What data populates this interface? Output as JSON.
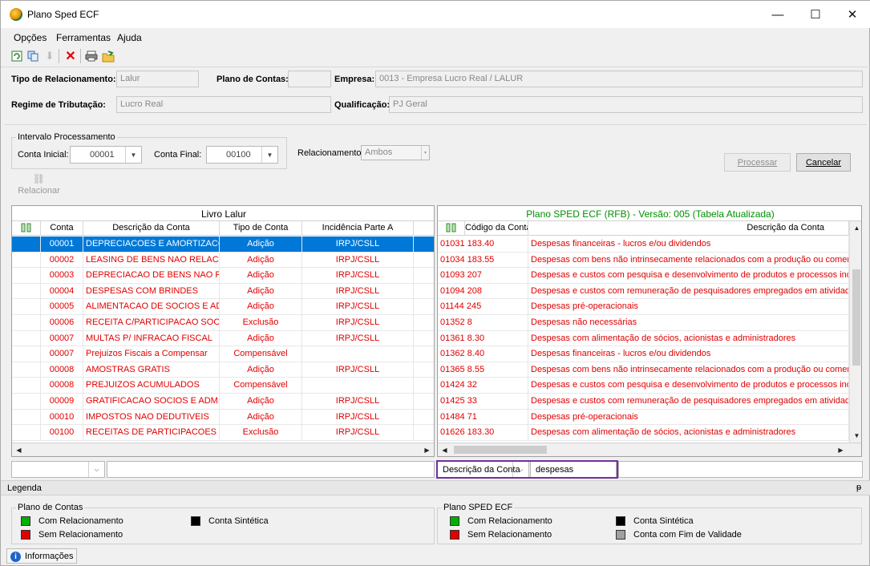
{
  "window": {
    "title": "Plano Sped ECF",
    "minimize": "—",
    "maximize": "☐",
    "close": "✕"
  },
  "menu": {
    "opcoes": "Opções",
    "ferramentas": "Ferramentas",
    "ajuda": "Ajuda"
  },
  "header": {
    "tipo_relacionamento_label": "Tipo de Relacionamento:",
    "tipo_relacionamento_value": "Lalur",
    "plano_contas_label": "Plano de Contas:",
    "plano_contas_value": "",
    "empresa_label": "Empresa:",
    "empresa_value": "0013 - Empresa Lucro Real / LALUR",
    "regime_label": "Regime de Tributação:",
    "regime_value": "Lucro Real",
    "qualificacao_label": "Qualificação:",
    "qualificacao_value": "PJ Geral"
  },
  "intervalo": {
    "title": "Intervalo Processamento",
    "conta_inicial_label": "Conta Inicial:",
    "conta_inicial_value": "00001",
    "conta_final_label": "Conta Final:",
    "conta_final_value": "00100",
    "relacionamento_label": "Relacionamento:",
    "relacionamento_value": "Ambos"
  },
  "buttons": {
    "processar": "Processar",
    "cancelar": "Cancelar",
    "relacionar": "Relacionar"
  },
  "left_grid": {
    "title": "Livro Lalur",
    "columns": [
      "Conta",
      "Descrição da Conta",
      "Tipo de Conta",
      "Incidência Parte A"
    ],
    "rows": [
      {
        "conta": "00001",
        "desc": "DEPRECIACOES E AMORTIZACOES I",
        "tipo": "Adição",
        "inc": "IRPJ/CSLL"
      },
      {
        "conta": "00002",
        "desc": "LEASING DE BENS NAO RELACIONAI",
        "tipo": "Adição",
        "inc": "IRPJ/CSLL"
      },
      {
        "conta": "00003",
        "desc": "DEPRECIACAO DE BENS NAO RELAC",
        "tipo": "Adição",
        "inc": "IRPJ/CSLL"
      },
      {
        "conta": "00004",
        "desc": "DESPESAS COM BRINDES",
        "tipo": "Adição",
        "inc": "IRPJ/CSLL"
      },
      {
        "conta": "00005",
        "desc": "ALIMENTACAO DE SOCIOS E ADMIN",
        "tipo": "Adição",
        "inc": "IRPJ/CSLL"
      },
      {
        "conta": "00006",
        "desc": "RECEITA C/PARTICIPACAO SOCIET",
        "tipo": "Exclusão",
        "inc": "IRPJ/CSLL"
      },
      {
        "conta": "00007",
        "desc": "MULTAS P/ INFRACAO FISCAL",
        "tipo": "Adição",
        "inc": "IRPJ/CSLL"
      },
      {
        "conta": "00007",
        "desc": "Prejuizos Fiscais a Compensar",
        "tipo": "Compensável",
        "inc": ""
      },
      {
        "conta": "00008",
        "desc": "AMOSTRAS GRATIS",
        "tipo": "Adição",
        "inc": "IRPJ/CSLL"
      },
      {
        "conta": "00008",
        "desc": "PREJUIZOS ACUMULADOS",
        "tipo": "Compensável",
        "inc": ""
      },
      {
        "conta": "00009",
        "desc": "GRATIFICACAO SOCIOS E ADMINIS",
        "tipo": "Adição",
        "inc": "IRPJ/CSLL"
      },
      {
        "conta": "00010",
        "desc": "IMPOSTOS NAO DEDUTIVEIS",
        "tipo": "Adição",
        "inc": "IRPJ/CSLL"
      },
      {
        "conta": "00100",
        "desc": "RECEITAS DE PARTICIPACOES SOC",
        "tipo": "Exclusão",
        "inc": "IRPJ/CSLL"
      }
    ]
  },
  "right_grid": {
    "title": "Plano SPED ECF (RFB) - Versão: 005 (Tabela Atualizada)",
    "columns": [
      "Código da Conta",
      "Descrição da Conta"
    ],
    "rows": [
      {
        "cod": "01031",
        "num": "183.40",
        "desc": "Despesas financeiras - lucros e/ou dividendos"
      },
      {
        "cod": "01034",
        "num": "183.55",
        "desc": "Despesas com bens não intrinsecamente relacionados com a produção ou comercialização"
      },
      {
        "cod": "01093",
        "num": "207",
        "desc": "Despesas e custos com pesquisa e desenvolvimento de produtos e processos inovadores"
      },
      {
        "cod": "01094",
        "num": "208",
        "desc": "Despesas e custos com remuneração de pesquisadores empregados em atividades de inc"
      },
      {
        "cod": "01144",
        "num": "245",
        "desc": "Despesas pré-operacionais"
      },
      {
        "cod": "01352",
        "num": "8",
        "desc": "Despesas não necessárias"
      },
      {
        "cod": "01361",
        "num": "8.30",
        "desc": "Despesas com alimentação de sócios, acionistas e administradores"
      },
      {
        "cod": "01362",
        "num": "8.40",
        "desc": "Despesas financeiras - lucros e/ou dividendos"
      },
      {
        "cod": "01365",
        "num": "8.55",
        "desc": "Despesas com bens não intrinsecamente relacionados com a produção ou comercialização"
      },
      {
        "cod": "01424",
        "num": "32",
        "desc": "Despesas e custos com pesquisa e desenvolvimento de produtos e processos inovadores"
      },
      {
        "cod": "01425",
        "num": "33",
        "desc": "Despesas e custos com remuneração de pesquisadores empregados em atividades de inc"
      },
      {
        "cod": "01484",
        "num": "71",
        "desc": "Despesas pré-operacionais"
      },
      {
        "cod": "01626",
        "num": "183.30",
        "desc": "Despesas com alimentação de sócios, acionistas e administradores"
      }
    ]
  },
  "filter": {
    "left_value": "",
    "left_text": "",
    "right_field": "Descrição da Conta",
    "right_text": "despesas"
  },
  "legend": {
    "title": "Legenda",
    "pin": "ᵽ",
    "plano_contas_title": "Plano de Contas",
    "sped_title": "Plano SPED ECF",
    "com_relacionamento": "Com Relacionamento",
    "sem_relacionamento": "Sem Relacionamento",
    "conta_sintetica": "Conta Sintética",
    "conta_fim_validade": "Conta com Fim de Validade"
  },
  "status": {
    "informacoes": "Informações"
  },
  "colors": {
    "green": "#00b000",
    "red": "#e00000",
    "black": "#000000",
    "gray": "#a0a0a0",
    "selection": "#0078d7",
    "sped_title": "#009000"
  }
}
